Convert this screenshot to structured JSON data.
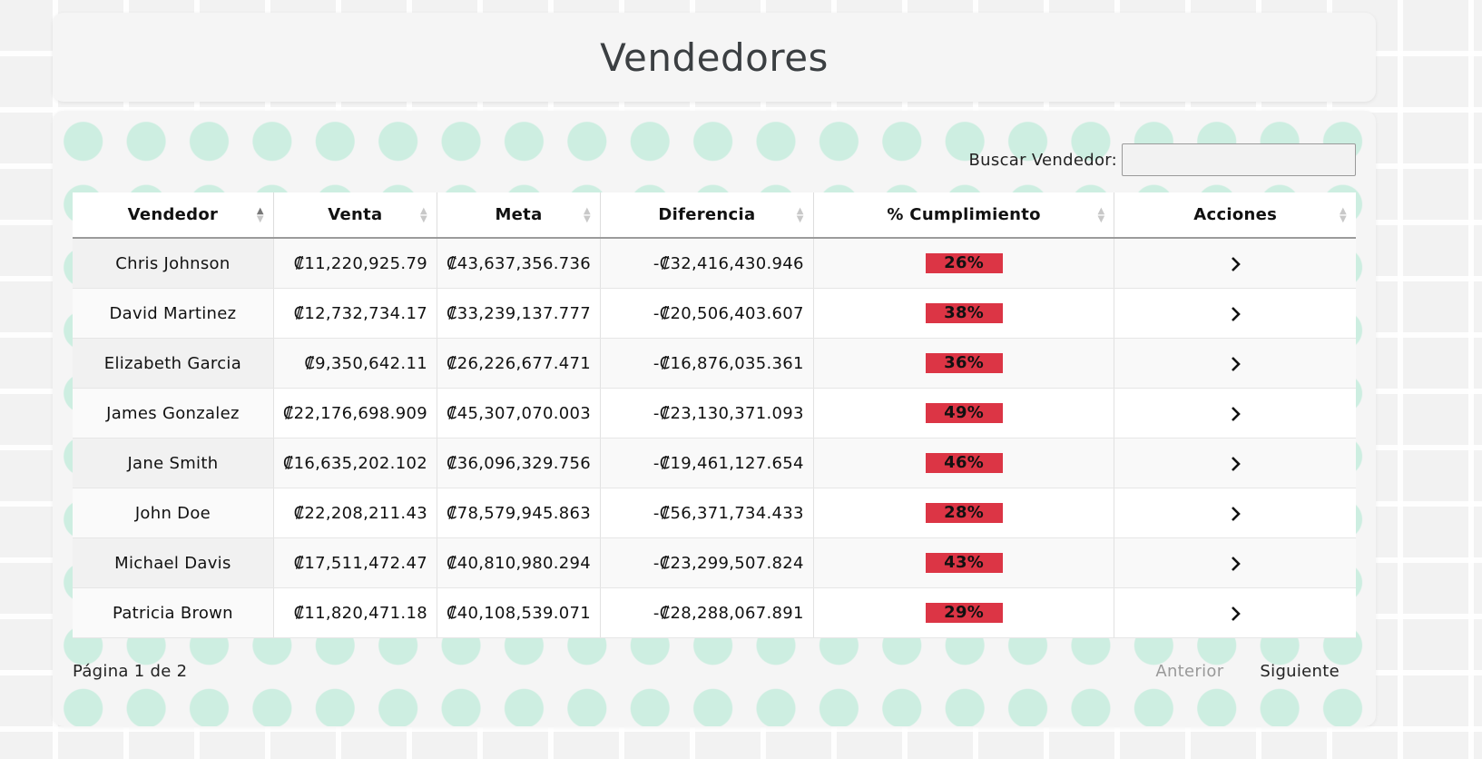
{
  "header": {
    "title": "Vendedores"
  },
  "search": {
    "label": "Buscar Vendedor:",
    "value": "",
    "placeholder": ""
  },
  "table": {
    "columns": [
      "Vendedor",
      "Venta",
      "Meta",
      "Diferencia",
      "% Cumplimiento",
      "Acciones"
    ],
    "rows": [
      {
        "vendedor": "Chris Johnson",
        "venta": "₡11,220,925.79",
        "meta": "₡43,637,356.736",
        "diferencia": "-₡32,416,430.946",
        "cumplimiento": "26%"
      },
      {
        "vendedor": "David Martinez",
        "venta": "₡12,732,734.17",
        "meta": "₡33,239,137.777",
        "diferencia": "-₡20,506,403.607",
        "cumplimiento": "38%"
      },
      {
        "vendedor": "Elizabeth Garcia",
        "venta": "₡9,350,642.11",
        "meta": "₡26,226,677.471",
        "diferencia": "-₡16,876,035.361",
        "cumplimiento": "36%"
      },
      {
        "vendedor": "James Gonzalez",
        "venta": "₡22,176,698.909",
        "meta": "₡45,307,070.003",
        "diferencia": "-₡23,130,371.093",
        "cumplimiento": "49%"
      },
      {
        "vendedor": "Jane Smith",
        "venta": "₡16,635,202.102",
        "meta": "₡36,096,329.756",
        "diferencia": "-₡19,461,127.654",
        "cumplimiento": "46%"
      },
      {
        "vendedor": "John Doe",
        "venta": "₡22,208,211.43",
        "meta": "₡78,579,945.863",
        "diferencia": "-₡56,371,734.433",
        "cumplimiento": "28%"
      },
      {
        "vendedor": "Michael Davis",
        "venta": "₡17,511,472.47",
        "meta": "₡40,810,980.294",
        "diferencia": "-₡23,299,507.824",
        "cumplimiento": "43%"
      },
      {
        "vendedor": "Patricia Brown",
        "venta": "₡11,820,471.18",
        "meta": "₡40,108,539.071",
        "diferencia": "-₡28,288,067.891",
        "cumplimiento": "29%"
      }
    ],
    "action_icon": "chevron-right-icon",
    "sort_column": "Vendedor",
    "sort_direction": "ascending",
    "badge_color": "#dc3545"
  },
  "pagination": {
    "info": "Página 1 de 2",
    "prev_label": "Anterior",
    "next_label": "Siguiente",
    "prev_disabled": true
  },
  "colors": {
    "dots": "#cdeee1",
    "card": "#f5f5f5",
    "title": "#3b3f42"
  }
}
